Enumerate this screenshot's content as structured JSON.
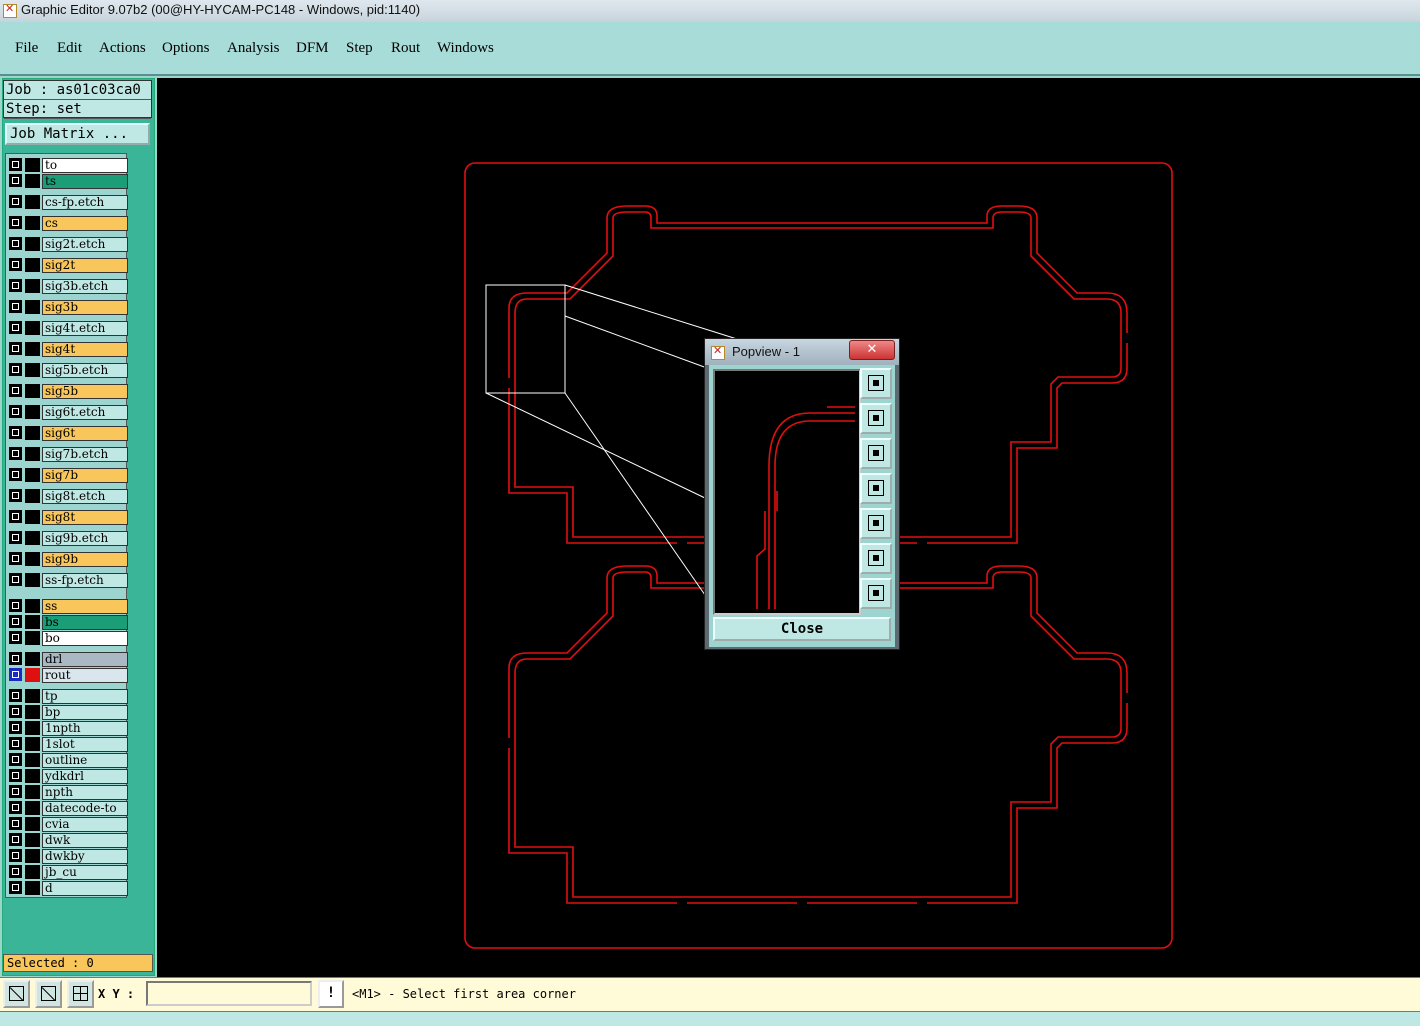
{
  "window": {
    "title": "Graphic Editor 9.07b2 (00@HY-HYCAM-PC148 - Windows, pid:1140)"
  },
  "menu": [
    {
      "label": "File"
    },
    {
      "label": "Edit"
    },
    {
      "label": "Actions"
    },
    {
      "label": "Options"
    },
    {
      "label": "Analysis"
    },
    {
      "label": "DFM"
    },
    {
      "label": "Step"
    },
    {
      "label": "Rout"
    },
    {
      "label": "Windows"
    }
  ],
  "job": {
    "job_line": "Job : as01c03ca0",
    "step_line": "Step: set"
  },
  "job_matrix_label": "Job Matrix ...",
  "layers": [
    {
      "name": "to",
      "color": "#ffffff"
    },
    {
      "name": "ts",
      "color": "#1b9e77"
    },
    {
      "name": "cs-fp.etch",
      "color": "#bfe8e4"
    },
    {
      "name": "cs",
      "color": "#f8c65a"
    },
    {
      "name": "sig2t.etch",
      "color": "#bfe8e4"
    },
    {
      "name": "sig2t",
      "color": "#f8c65a"
    },
    {
      "name": "sig3b.etch",
      "color": "#bfe8e4"
    },
    {
      "name": "sig3b",
      "color": "#f8c65a"
    },
    {
      "name": "sig4t.etch",
      "color": "#bfe8e4"
    },
    {
      "name": "sig4t",
      "color": "#f8c65a"
    },
    {
      "name": "sig5b.etch",
      "color": "#bfe8e4"
    },
    {
      "name": "sig5b",
      "color": "#f8c65a"
    },
    {
      "name": "sig6t.etch",
      "color": "#bfe8e4"
    },
    {
      "name": "sig6t",
      "color": "#f8c65a"
    },
    {
      "name": "sig7b.etch",
      "color": "#bfe8e4"
    },
    {
      "name": "sig7b",
      "color": "#f8c65a"
    },
    {
      "name": "sig8t.etch",
      "color": "#bfe8e4"
    },
    {
      "name": "sig8t",
      "color": "#f8c65a"
    },
    {
      "name": "sig9b.etch",
      "color": "#bfe8e4"
    },
    {
      "name": "sig9b",
      "color": "#f8c65a"
    },
    {
      "name": "ss-fp.etch",
      "color": "#bfe8e4"
    },
    {
      "name": "ss",
      "color": "#f8c65a"
    },
    {
      "name": "bs",
      "color": "#1b9e77"
    },
    {
      "name": "bo",
      "color": "#ffffff"
    },
    {
      "name": "drl",
      "color": "#a9b8c2"
    },
    {
      "name": "rout",
      "color": "#d9e6ee",
      "active": true
    },
    {
      "name": "tp",
      "color": "#bfe8e4"
    },
    {
      "name": "bp",
      "color": "#bfe8e4"
    },
    {
      "name": "1npth",
      "color": "#bfe8e4"
    },
    {
      "name": "1slot",
      "color": "#bfe8e4"
    },
    {
      "name": "outline",
      "color": "#bfe8e4"
    },
    {
      "name": "ydkdrl",
      "color": "#bfe8e4"
    },
    {
      "name": "npth",
      "color": "#bfe8e4"
    },
    {
      "name": "datecode-to",
      "color": "#bfe8e4"
    },
    {
      "name": "cvia",
      "color": "#bfe8e4"
    },
    {
      "name": "dwk",
      "color": "#bfe8e4"
    },
    {
      "name": "dwkby",
      "color": "#bfe8e4"
    },
    {
      "name": "jb_cu",
      "color": "#bfe8e4"
    },
    {
      "name": "d",
      "color": "#bfe8e4"
    }
  ],
  "selected_label": "Selected : 0",
  "popview": {
    "title": "Popview - 1",
    "close_label": "Close",
    "close_x": "✕"
  },
  "status": {
    "xy_label": "X Y :",
    "xy_value": "",
    "warn": "!",
    "message": "<M1> - Select first area corner"
  },
  "colors": {
    "canvas": "#000000",
    "rout_line": "#e01010",
    "panel": "#3bb597",
    "menu_bg": "#a7dcd8"
  }
}
